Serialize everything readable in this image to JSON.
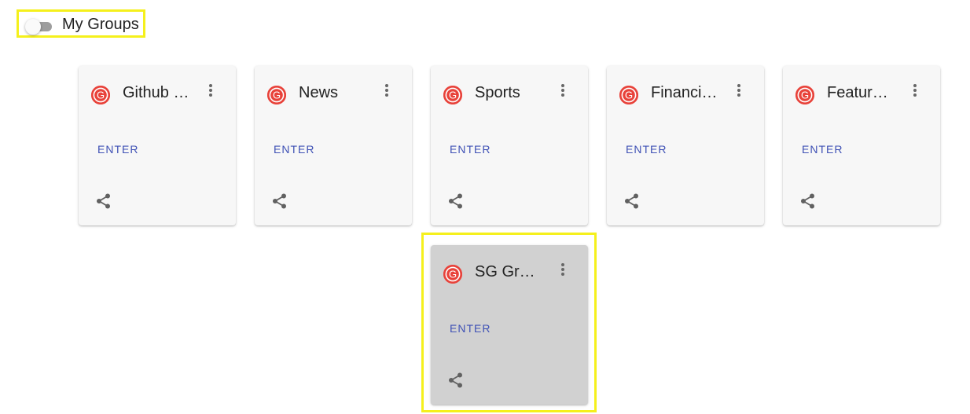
{
  "toggle": {
    "label": "My Groups",
    "checked": false
  },
  "colors": {
    "avatar": "#e8423a",
    "enter": "#3f51b5",
    "highlight": "#f5f01c",
    "card_bg": "#f7f7f7",
    "card_selected_bg": "#d1d1d1"
  },
  "cards": [
    {
      "title": "Github …",
      "action": "ENTER",
      "avatar_letter": "G",
      "icon": "share-icon"
    },
    {
      "title": "News",
      "action": "ENTER",
      "avatar_letter": "G",
      "icon": "share-icon"
    },
    {
      "title": "Sports",
      "action": "ENTER",
      "avatar_letter": "G",
      "icon": "share-icon"
    },
    {
      "title": "Financi…",
      "action": "ENTER",
      "avatar_letter": "G",
      "icon": "share-icon"
    },
    {
      "title": "Featur…",
      "action": "ENTER",
      "avatar_letter": "G",
      "icon": "share-icon"
    },
    {
      "title": "SG Gr…",
      "action": "ENTER",
      "avatar_letter": "G",
      "icon": "share-icon"
    }
  ]
}
